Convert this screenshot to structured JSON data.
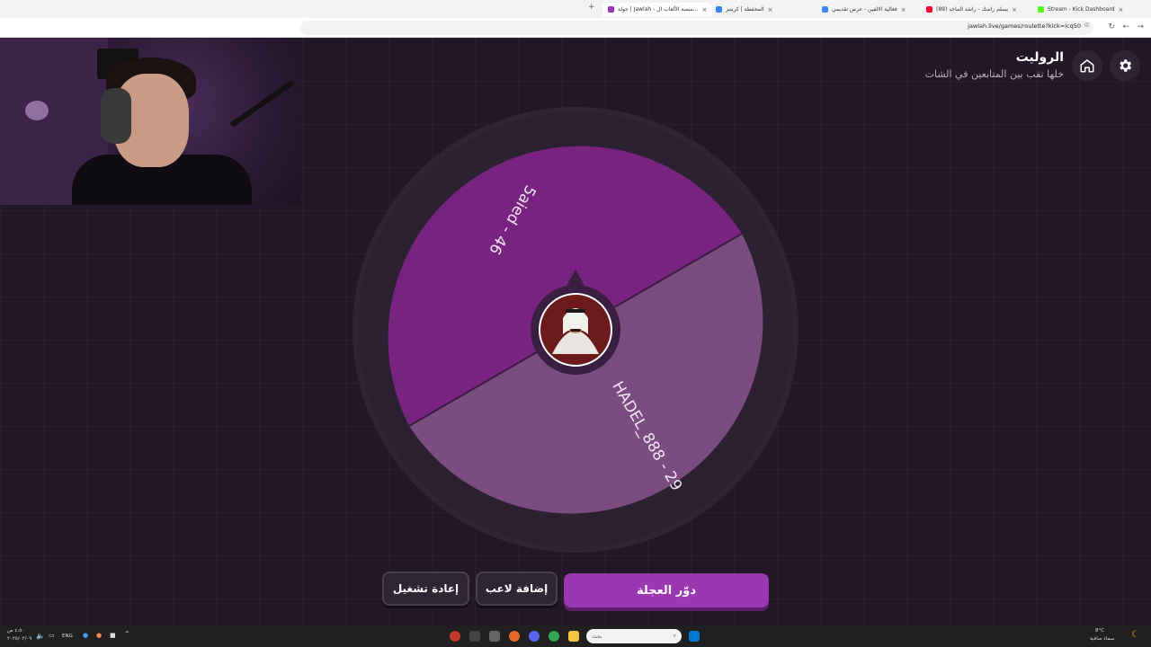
{
  "browser": {
    "tabs": [
      {
        "label": "Stream - Kick Dashboard",
        "fav": "#53fc18"
      },
      {
        "label": "(89) يسلم راسك - راشد الماجد",
        "fav": "#ff0033"
      },
      {
        "label": "فعالية الالفين - عرض تقديمي",
        "fav": "#4285f4"
      },
      {
        "label": "المحفظة | كريتيز",
        "fav": "#3b82f6"
      },
      {
        "label": "جولة | Jawlah - منصة الألعاب ال...",
        "fav": "#9b37b0"
      }
    ],
    "url": "jawlah.live/games/roulette?kick=icq50"
  },
  "header": {
    "title": "الروليت",
    "subtitle": "خلها تقب بين المتابعين في الشات",
    "settings_icon": "gear-icon",
    "home_icon": "home-icon"
  },
  "wheel": {
    "segments": [
      {
        "label": "5aied - 46",
        "color": "#77237f"
      },
      {
        "label": "HADEL_888 - 29",
        "color": "#7b4c80"
      }
    ],
    "rim_color": "#2e2433",
    "center_icon": "avatar"
  },
  "buttons": {
    "spin": "دوّر العجلة",
    "add_player": "إضافة لاعب",
    "restart": "إعادة تشغيل"
  },
  "taskbar": {
    "search_placeholder": "بحث",
    "language": "ENG",
    "time": "٤:٥٠ ص",
    "date": "٢٠٢٥/٠٢/٠٩",
    "weather_temp": "8°C",
    "weather_desc": "سماء صافية"
  }
}
